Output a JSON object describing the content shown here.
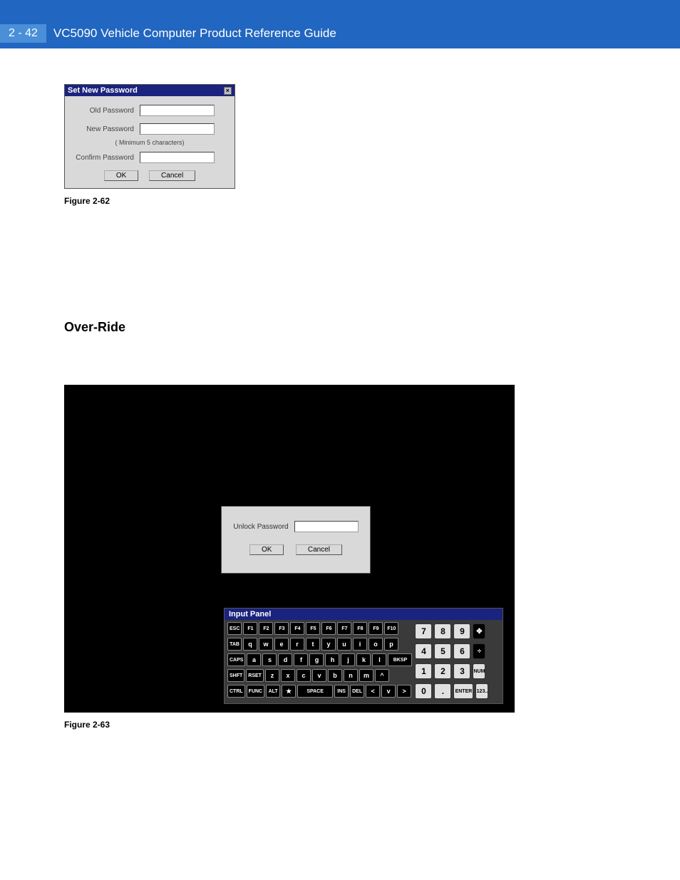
{
  "header": {
    "page_number": "2 - 42",
    "doc_title": "VC5090 Vehicle Computer Product Reference Guide"
  },
  "dialog_set_pw": {
    "title": "Set New Password",
    "close": "×",
    "old_label": "Old Password",
    "new_label": "New Password",
    "hint": "( Minimum 5 characters)",
    "confirm_label": "Confirm Password",
    "ok": "OK",
    "cancel": "Cancel"
  },
  "figure1_caption": "Figure 2-62",
  "section_override": "Over-Ride",
  "unlock_dialog": {
    "label": "Unlock Password",
    "ok": "OK",
    "cancel": "Cancel"
  },
  "keyboard": {
    "title": "Input Panel",
    "row1": [
      "ESC",
      "F1",
      "F2",
      "F3",
      "F4",
      "F5",
      "F6",
      "F7",
      "F8",
      "F9",
      "F10"
    ],
    "row2": [
      "TAB",
      "q",
      "w",
      "e",
      "r",
      "t",
      "y",
      "u",
      "i",
      "o",
      "p"
    ],
    "row3": [
      "CAPS",
      "a",
      "s",
      "d",
      "f",
      "g",
      "h",
      "j",
      "k",
      "l"
    ],
    "row4": [
      "SHFT",
      "RSET",
      "z",
      "x",
      "c",
      "v",
      "b",
      "n",
      "m",
      "^"
    ],
    "row5": [
      "CTRL",
      "FUNC",
      "ALT",
      "★",
      "SPACE",
      "INS",
      "DEL",
      "<",
      "v",
      ">"
    ],
    "bksp": "BKSP",
    "num": "NUM",
    "enter": "ENTER",
    "ext": "123..",
    "drag": "✥",
    "div": "÷",
    "n7": "7",
    "n8": "8",
    "n9": "9",
    "n4": "4",
    "n5": "5",
    "n6": "6",
    "n1": "1",
    "n2": "2",
    "n3": "3",
    "n0": "0",
    "ndot": "."
  },
  "figure2_caption": "Figure 2-63"
}
